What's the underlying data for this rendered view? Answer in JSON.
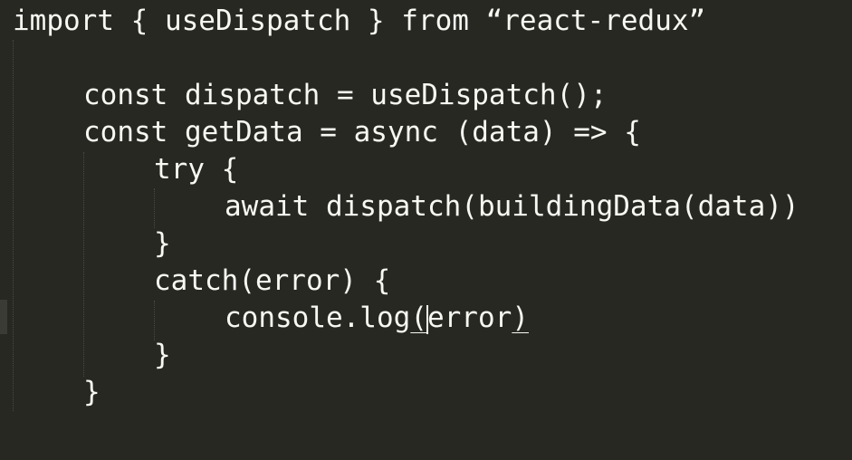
{
  "editor": {
    "background": "#272822",
    "foreground": "#f8f8f2",
    "lines": [
      "import { useDispatch } from “react-redux”",
      "const dispatch = useDispatch();",
      "const getData = async (data) => {",
      "try {",
      "await dispatch(buildingData(data))",
      "}",
      "catch(error) {",
      "console.log",
      "(",
      "error",
      ")",
      "}",
      "}"
    ]
  }
}
